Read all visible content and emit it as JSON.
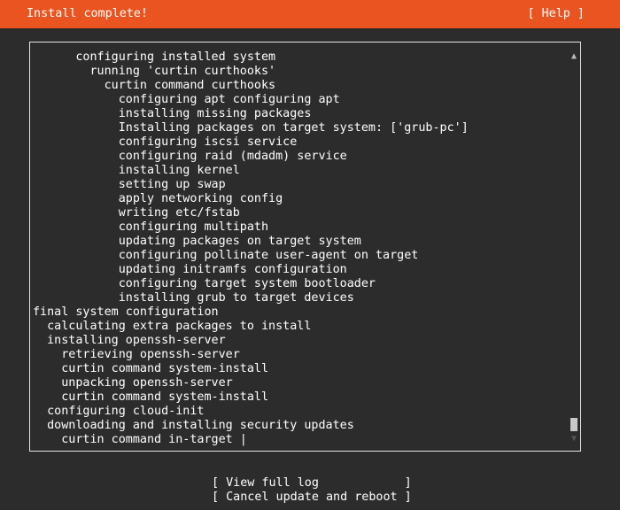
{
  "header": {
    "title": "Install complete!",
    "help_label": "[ Help ]"
  },
  "log": {
    "lines": [
      "      configuring installed system",
      "        running 'curtin curthooks'",
      "          curtin command curthooks",
      "            configuring apt configuring apt",
      "            installing missing packages",
      "            Installing packages on target system: ['grub-pc']",
      "            configuring iscsi service",
      "            configuring raid (mdadm) service",
      "            installing kernel",
      "            setting up swap",
      "            apply networking config",
      "            writing etc/fstab",
      "            configuring multipath",
      "            updating packages on target system",
      "            configuring pollinate user-agent on target",
      "            updating initramfs configuration",
      "            configuring target system bootloader",
      "            installing grub to target devices",
      "final system configuration",
      "  calculating extra packages to install",
      "  installing openssh-server",
      "    retrieving openssh-server",
      "    curtin command system-install",
      "    unpacking openssh-server",
      "    curtin command system-install",
      "  configuring cloud-init",
      "  downloading and installing security updates",
      "    curtin command in-target |"
    ]
  },
  "scrollbar": {
    "up_glyph": "▲",
    "down_glyph": "▼"
  },
  "actions": {
    "view_full_log": "[ View full log            ]",
    "cancel_update_reboot": "[ Cancel update and reboot ]"
  }
}
